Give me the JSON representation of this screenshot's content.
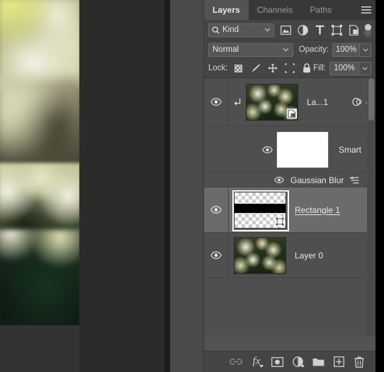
{
  "app": {
    "name": "Adobe Photoshop",
    "panel_title": "Layers"
  },
  "colors": {
    "panel_bg": "#535353",
    "list_bg": "#4f4f4f",
    "row_selected": "#6b6b6b",
    "toolbar_bg": "#454545",
    "tabbar_bg": "#383838",
    "text": "#e9e9e9",
    "text_dim": "#9a9a9a",
    "canvas_bg": "#292929"
  },
  "tabs": [
    {
      "label": "Layers",
      "active": true
    },
    {
      "label": "Channels",
      "active": false
    },
    {
      "label": "Paths",
      "active": false
    }
  ],
  "panel_menu_icon": "hamburger-menu-icon",
  "filter_bar": {
    "kind_label": "Kind",
    "search_icon": "search-icon",
    "caret_icon": "chevron-down-icon",
    "filter_icons": [
      "pixel-layer-filter-icon",
      "adjustment-layer-filter-icon",
      "type-layer-filter-icon",
      "shape-layer-filter-icon",
      "smart-object-filter-icon"
    ],
    "toggle_icon": "filter-enable-toggle"
  },
  "blend_row": {
    "blend_mode": "Normal",
    "blend_caret": "chevron-down-icon",
    "opacity_label": "Opacity:",
    "opacity_value": "100%",
    "opacity_caret": "chevron-down-icon"
  },
  "lock_row": {
    "lock_label": "Lock:",
    "lock_icons": [
      "lock-transparent-pixels-icon",
      "lock-image-pixels-icon",
      "lock-position-icon",
      "lock-artboard-nesting-icon",
      "lock-all-icon"
    ],
    "fill_label": "Fill:",
    "fill_value": "100%",
    "fill_caret": "chevron-down-icon"
  },
  "layers": [
    {
      "name": "La...1",
      "visible": true,
      "selected": false,
      "clipped": true,
      "thumb": "flower-photo",
      "badge": "smart-object-badge",
      "right_icons": [
        "smart-filters-toggle-icon",
        "chevron-up-icon"
      ],
      "eye_icon": "eye-icon"
    },
    {
      "name": "Smart",
      "type": "smart-filters-header",
      "visible": true,
      "thumb": "white-mask",
      "eye_icon": "eye-icon"
    },
    {
      "name": "Gaussian Blur",
      "type": "smart-filter",
      "visible": true,
      "eye_icon": "eye-icon",
      "settings_icon": "filter-blending-options-icon"
    },
    {
      "name": "Rectangle 1",
      "visible": true,
      "selected": true,
      "editing": true,
      "thumb": "checkerboard-with-black-band",
      "badge": "vector-shape-badge",
      "eye_icon": "eye-icon"
    },
    {
      "name": "Layer 0",
      "visible": true,
      "selected": false,
      "thumb": "flower-photo",
      "eye_icon": "eye-icon"
    }
  ],
  "bottom_toolbar": [
    {
      "name": "link-layers-icon",
      "label": "Link layers",
      "disabled": true
    },
    {
      "name": "layer-style-fx-icon",
      "label": "fx"
    },
    {
      "name": "add-layer-mask-icon",
      "label": "Add layer mask"
    },
    {
      "name": "new-adjustment-layer-icon",
      "label": "New adjustment layer"
    },
    {
      "name": "new-group-icon",
      "label": "New group"
    },
    {
      "name": "new-layer-icon",
      "label": "New layer"
    },
    {
      "name": "delete-layer-icon",
      "label": "Delete layer"
    }
  ],
  "canvas": {
    "description": "blurred chrysanthemum flowers photograph"
  }
}
